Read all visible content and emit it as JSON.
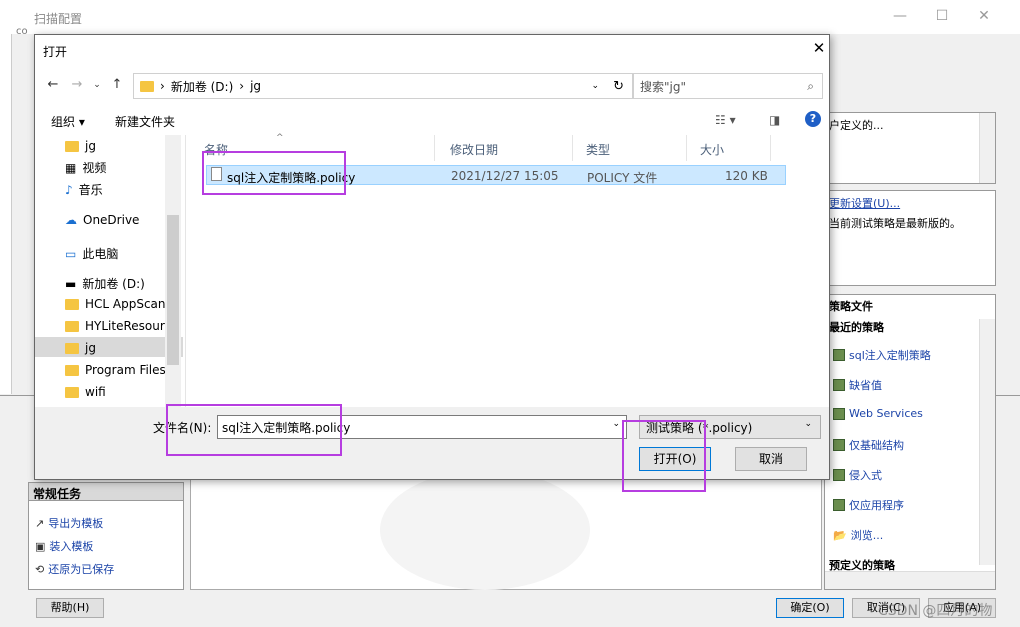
{
  "background_window": {
    "title": "扫描配置",
    "left_fragment": "co",
    "common_tasks": {
      "title": "常规任务",
      "items": [
        {
          "icon": "export-template-icon",
          "label": "导出为模板"
        },
        {
          "icon": "load-template-icon",
          "label": "装入模板"
        },
        {
          "icon": "restore-saved-icon",
          "label": "还原为已保存"
        }
      ]
    },
    "right_panel_1_text": "户定义的...",
    "update": {
      "link": "更新设置(U)...",
      "status": "当前测试策略是最新版的。"
    },
    "policy_panel": {
      "title": "策略文件",
      "recent_heading": "最近的策略",
      "items": [
        "sql注入定制策略",
        "缺省值",
        "Web Services",
        "仅基础结构",
        "侵入式",
        "仅应用程序",
        "浏览..."
      ],
      "predefined_heading": "预定义的策略"
    },
    "buttons": {
      "help": "帮助(H)",
      "ok": "确定(O)",
      "cancel": "取消(C)",
      "apply": "应用(A)"
    },
    "watermark": "CSDN @四月的物"
  },
  "dialog": {
    "title": "打开",
    "address_parts": [
      "新加卷 (D:)",
      "jg"
    ],
    "search_placeholder": "搜索\"jg\"",
    "toolbar": {
      "organize": "组织 ▾",
      "new_folder": "新建文件夹"
    },
    "tree": [
      "jg",
      "视频",
      "音乐",
      "OneDrive",
      "此电脑",
      "新加卷 (D:)",
      "HCL AppScan S",
      "HYLiteResource",
      "jg",
      "Program Files (",
      "wifi"
    ],
    "columns": {
      "name": "名称",
      "date": "修改日期",
      "type": "类型",
      "size": "大小"
    },
    "files": [
      {
        "name": "sql注入定制策略.policy",
        "date": "2021/12/27 15:05",
        "type": "POLICY 文件",
        "size": "120 KB"
      }
    ],
    "filename_label": "文件名(N):",
    "filename_value": "sql注入定制策略.policy",
    "filetype": "测试策略 (*.policy)",
    "open_button": "打开(O)",
    "cancel_button": "取消"
  }
}
